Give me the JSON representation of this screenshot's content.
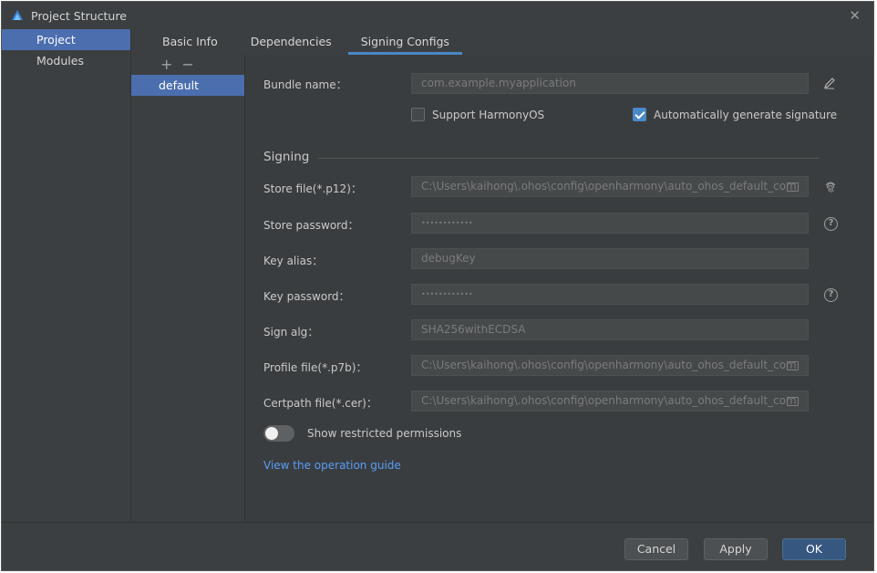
{
  "window": {
    "title": "Project Structure"
  },
  "nav": {
    "items": [
      {
        "label": "Project"
      },
      {
        "label": "Modules"
      }
    ]
  },
  "tabs": [
    {
      "label": "Basic Info"
    },
    {
      "label": "Dependencies"
    },
    {
      "label": "Signing Configs"
    }
  ],
  "configs": {
    "add": "+",
    "remove": "−",
    "items": [
      {
        "label": "default"
      }
    ]
  },
  "form": {
    "bundle_label": "Bundle name：",
    "bundle_placeholder": "com.example.myapplication",
    "support_harmony": {
      "label": "Support HarmonyOS",
      "checked": false
    },
    "auto_sign": {
      "label": "Automatically generate signature",
      "checked": true
    },
    "signing_title": "Signing",
    "store_file": {
      "label": "Store file(*.p12)：",
      "value": "C:\\Users\\kaihong\\.ohos\\config\\openharmony\\auto_ohos_default_com"
    },
    "store_password": {
      "label": "Store password：",
      "value": "••••••••••••"
    },
    "key_alias": {
      "label": "Key alias：",
      "value": "debugKey"
    },
    "key_password": {
      "label": "Key password：",
      "value": "••••••••••••"
    },
    "sign_alg": {
      "label": "Sign alg：",
      "value": "SHA256withECDSA"
    },
    "profile_file": {
      "label": "Profile file(*.p7b)：",
      "value": "C:\\Users\\kaihong\\.ohos\\config\\openharmony\\auto_ohos_default_com"
    },
    "certpath_file": {
      "label": "Certpath file(*.cer)：",
      "value": "C:\\Users\\kaihong\\.ohos\\config\\openharmony\\auto_ohos_default_com"
    },
    "restricted": {
      "label": "Show restricted permissions",
      "on": false
    },
    "guide_link": "View the operation guide"
  },
  "footer": {
    "cancel": "Cancel",
    "apply": "Apply",
    "ok": "OK"
  },
  "colors": {
    "accent": "#4b6eaf",
    "primary_button": "#365880",
    "link": "#589df6",
    "background": "#3c3f41"
  }
}
